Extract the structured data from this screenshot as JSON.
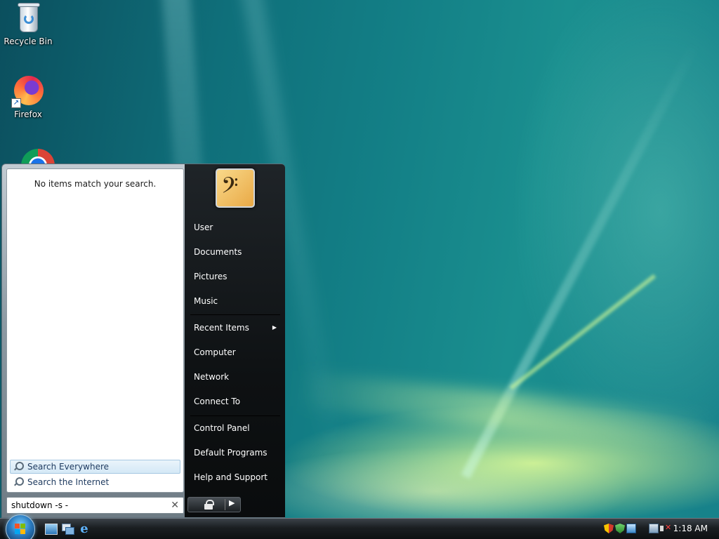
{
  "desktop": {
    "icons": [
      {
        "label": "Recycle Bin",
        "icon": "recycle-bin-icon"
      },
      {
        "label": "Firefox",
        "icon": "firefox-icon"
      },
      {
        "label": "",
        "icon": "chrome-icon"
      }
    ]
  },
  "start_menu": {
    "left_pane": {
      "no_results_text": "No items match your search.",
      "search_links": [
        {
          "label": "Search Everywhere",
          "icon": "magnifier-icon",
          "highlighted": true
        },
        {
          "label": "Search the Internet",
          "icon": "magnifier-icon",
          "highlighted": false
        }
      ]
    },
    "search": {
      "value": "shutdown -s -",
      "clear_glyph": "✕"
    },
    "user_picture": {
      "icon": "bass-clef-picture"
    },
    "right_pane": {
      "items": [
        {
          "label": "User"
        },
        {
          "label": "Documents"
        },
        {
          "label": "Pictures"
        },
        {
          "label": "Music"
        },
        {
          "label": "Recent Items",
          "has_submenu": true
        },
        {
          "label": "Computer"
        },
        {
          "label": "Network"
        },
        {
          "label": "Connect To"
        },
        {
          "label": "Control Panel"
        },
        {
          "label": "Default Programs"
        },
        {
          "label": "Help and Support"
        }
      ]
    },
    "power_buttons": {
      "lock_icon": "lock-icon",
      "arrow_glyph": "▶"
    }
  },
  "taskbar": {
    "start_icon": "windows-orb-icon",
    "quick_launch": [
      "show-desktop-icon",
      "switch-windows-icon",
      "internet-explorer-icon"
    ],
    "tray_icons": [
      "security-alert-icon",
      "windows-security-icon",
      "windows-update-icon",
      "network-icon",
      "volume-muted-icon"
    ],
    "clock": "1:18 AM"
  },
  "colors": {
    "taskbar": "#1a1e21",
    "start_right_pane": "#0e1113",
    "highlight": "#d4e8f6"
  }
}
